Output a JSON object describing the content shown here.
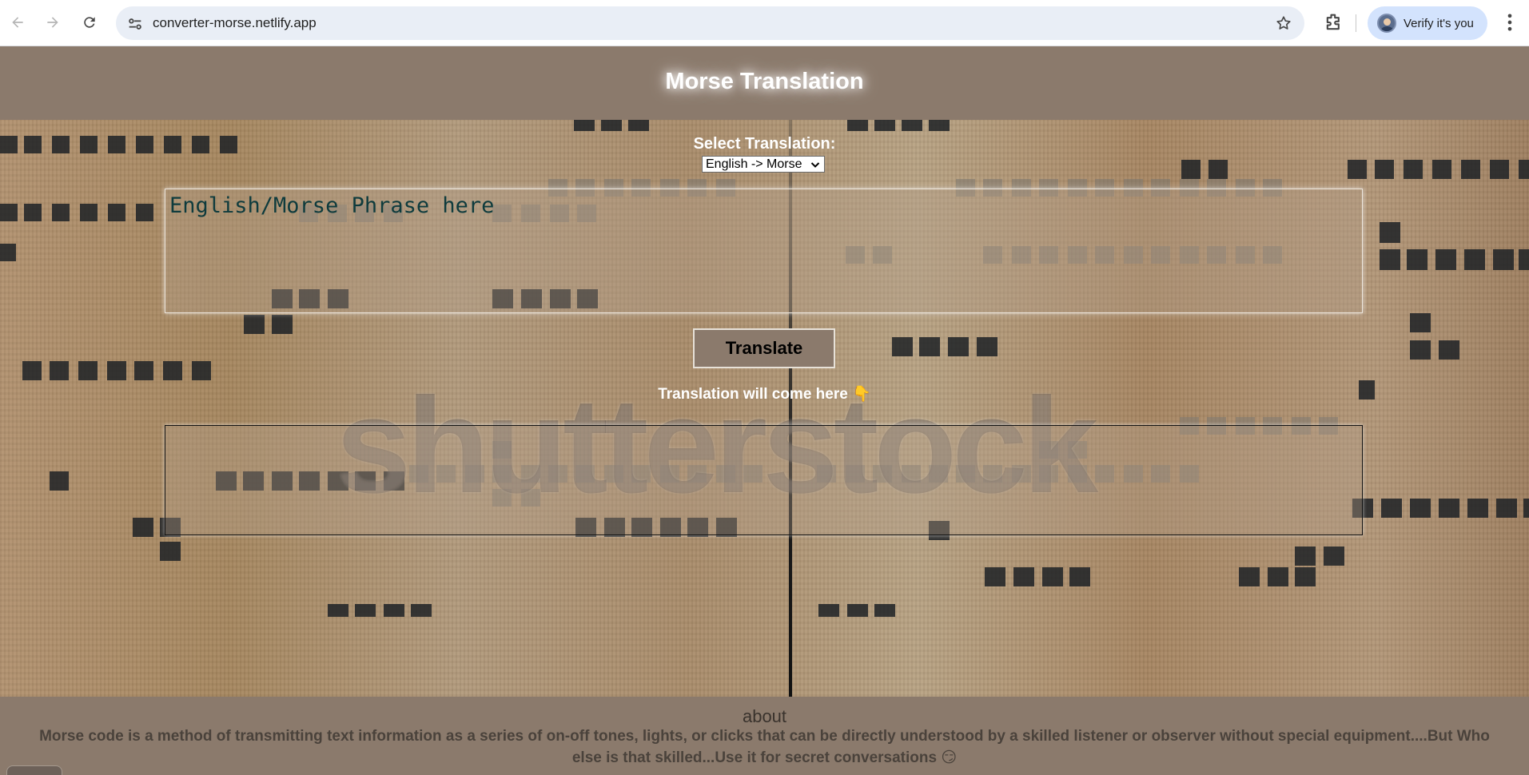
{
  "browser": {
    "url": "converter-morse.netlify.app",
    "profile_label": "Verify it's you",
    "icons": [
      "back-icon",
      "forward-icon",
      "reload-icon",
      "site-info-icon",
      "bookmark-star-icon",
      "extensions-icon",
      "kebab-menu-icon"
    ]
  },
  "header": {
    "title": "Morse Translation"
  },
  "form": {
    "select_label": "Select Translation:",
    "selected_option": "English -> Morse",
    "input_placeholder": "English/Morse Phrase here",
    "translate_button": "Translate",
    "result_label": "Translation will come here 👇",
    "output_value": ""
  },
  "background": {
    "watermark": "shutterstock"
  },
  "footer": {
    "heading": "about",
    "text": "Morse code is a method of transmitting text information as a series of on-off tones, lights, or clicks that can be directly understood by a skilled listener or observer without special equipment....But Who else is that skilled...Use it for secret conversations 😏"
  },
  "colors": {
    "page_bar": "#8b7a6c",
    "omnibox": "#e9eef6",
    "profile_pill": "#d3e3fd"
  }
}
